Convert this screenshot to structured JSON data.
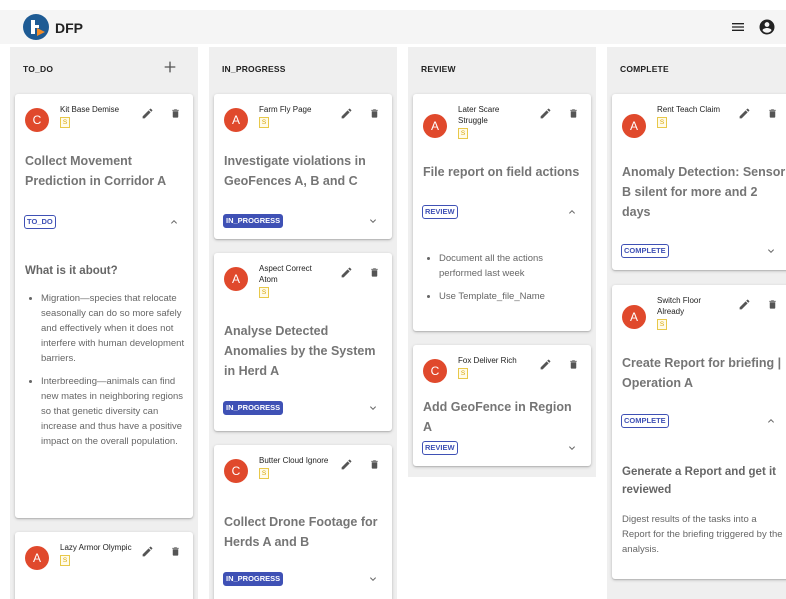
{
  "app": {
    "title": "DFP"
  },
  "columns": [
    {
      "title": "TO_DO"
    },
    {
      "title": "IN_PROGRESS"
    },
    {
      "title": "REVIEW"
    },
    {
      "title": "COMPLETE"
    }
  ],
  "cards": {
    "todo1": {
      "initial": "C",
      "name": "Kit Base Demise",
      "badge": "S",
      "title": "Collect Movement Prediction in Corridor A",
      "status": "TO_DO",
      "desc_heading": "What is it about?",
      "bullets": [
        "Migration—species that relocate seasonally can do so more safely and effectively when it does not interfere with human development barriers.",
        "Interbreeding—animals can find new mates in neighboring regions so that genetic diversity can increase and thus have a positive impact on the overall population."
      ]
    },
    "todo2": {
      "initial": "A",
      "name": "Lazy Armor Olympic",
      "badge": "S"
    },
    "prog1": {
      "initial": "A",
      "name": "Farm Fly Page",
      "badge": "S",
      "title": "Investigate violations in GeoFences A, B and C",
      "status": "IN_PROGRESS"
    },
    "prog2": {
      "initial": "A",
      "name": "Aspect Correct Atom",
      "badge": "S",
      "title": "Analyse Detected Anomalies by the System in Herd A",
      "status": "IN_PROGRESS"
    },
    "prog3": {
      "initial": "C",
      "name": "Butter Cloud Ignore",
      "badge": "S",
      "title": "Collect Drone Footage for Herds A and B",
      "status": "IN_PROGRESS"
    },
    "rev1": {
      "initial": "A",
      "name": "Later Scare Struggle",
      "badge": "S",
      "title": "File report on field actions",
      "status": "REVIEW",
      "bullets": [
        "Document all the actions performed last week",
        "Use Template_file_Name"
      ]
    },
    "rev2": {
      "initial": "C",
      "name": "Fox Deliver Rich",
      "badge": "S",
      "title": "Add GeoFence in Region A",
      "status": "REVIEW"
    },
    "comp1": {
      "initial": "A",
      "name": "Rent Teach Claim",
      "badge": "S",
      "title": "Anomaly Detection: Sensor B silent for more and 2 days",
      "status": "COMPLETE"
    },
    "comp2": {
      "initial": "A",
      "name": "Switch Floor Already",
      "badge": "S",
      "title": "Create Report for briefing | Operation A",
      "status": "COMPLETE",
      "desc_heading": "Generate a Report and get it reviewed",
      "desc_text": "Digest results of the tasks into a Report for the briefing triggered by the analysis."
    }
  },
  "colors": {
    "avatar": "#e0492c",
    "chip": "#3f51b5",
    "badge": "#e8c84a",
    "appbar": "#f5f5f5",
    "column": "#efefef"
  },
  "icons": [
    "logo-icon",
    "menu-icon",
    "account-icon",
    "add-icon",
    "edit-icon",
    "delete-icon",
    "expand-icon",
    "collapse-icon"
  ]
}
